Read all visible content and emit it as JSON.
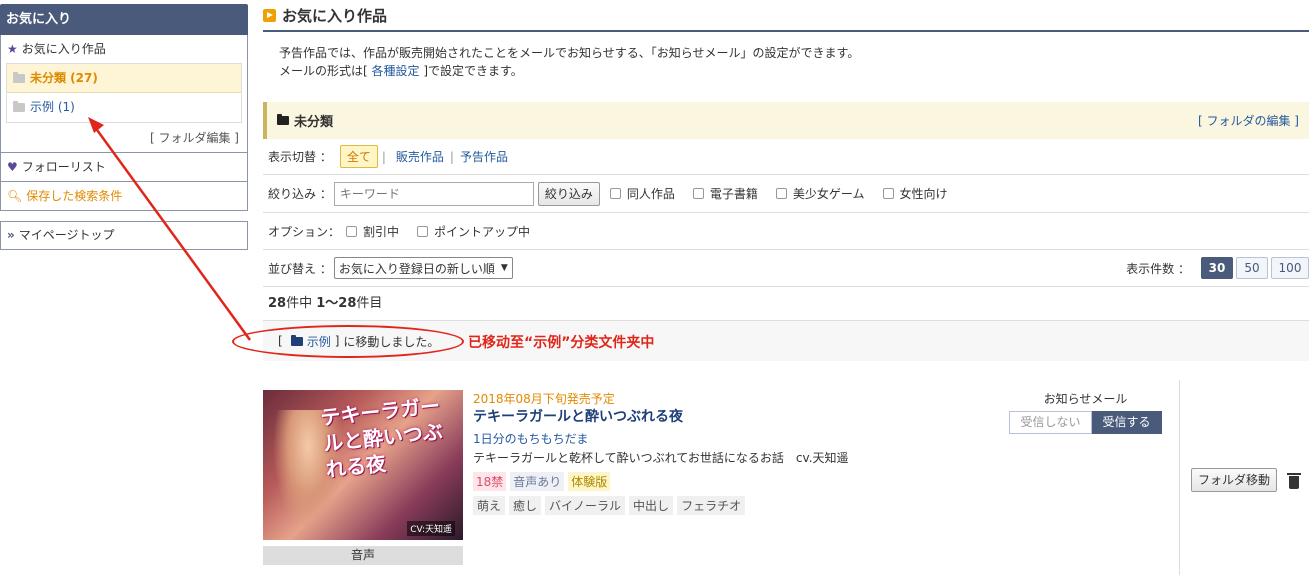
{
  "sidebar": {
    "header": "お気に入り",
    "favorites_label": "お気に入り作品",
    "folders": [
      {
        "label": "未分類 (27)"
      },
      {
        "label": "示例 (1)"
      }
    ],
    "folder_edit": "[ フォルダ編集 ]",
    "follow_list": "フォローリスト",
    "saved_search": "保存した検索条件",
    "mypage_top": "マイページトップ"
  },
  "main": {
    "title": "お気に入り作品",
    "intro_line1": "予告作品では、作品が販売開始されたことをメールでお知らせする、「お知らせメール」の設定ができます。",
    "intro_line2_pre": "メールの形式は[ ",
    "intro_line2_link": "各種設定",
    "intro_line2_post": " ]で設定できます。",
    "folder_name": "未分類",
    "folder_edit_link": "[ フォルダの編集 ]"
  },
  "filters": {
    "display_label": "表示切替 ：",
    "display_all": "全て",
    "display_sale": "販売作品",
    "display_preview": "予告作品",
    "narrow_label": "絞り込み ：",
    "keyword_placeholder": "キーワード",
    "narrow_button": "絞り込み",
    "narrow_options": [
      "同人作品",
      "電子書籍",
      "美少女ゲーム",
      "女性向け"
    ],
    "option_label": "オプション：",
    "option_items": [
      "割引中",
      "ポイントアップ中"
    ],
    "sort_label": "並び替え ：",
    "sort_value": "お気に入り登録日の新しい順",
    "perpage_label": "表示件数 ：",
    "perpage_options": [
      "30",
      "50",
      "100"
    ],
    "perpage_selected": "30"
  },
  "result": {
    "count_total": "28",
    "count_mid": "件中 ",
    "count_range": "1～28",
    "count_suffix": "件目"
  },
  "moved": {
    "bracket_open": "[",
    "folder_link": "示例",
    "bracket_close": "]",
    "message": "に移動しました。",
    "annotation": "已移动至“示例”分类文件夹中"
  },
  "work": {
    "thumb_title": "テキーラガールと酔いつぶれる夜",
    "thumb_credit": "CV:天知遥",
    "category": "音声",
    "release": "2018年08月下旬発売予定",
    "title": "テキーラガールと酔いつぶれる夜",
    "circle": "1日分のもちもちだま",
    "description": "テキーラガールと乾杯して酔いつぶれてお世話になるお話　cv.天知遥",
    "tags": [
      "18禁",
      "音声あり",
      "体験版"
    ],
    "genres": [
      "萌え",
      "癒し",
      "バイノーラル",
      "中出し",
      "フェラチオ"
    ],
    "notify_label": "お知らせメール",
    "notify_off": "受信しない",
    "notify_on": "受信する",
    "move_button": "フォルダ移動"
  },
  "colors": {
    "header_bg": "#4a5a7a",
    "accent_orange": "#e08a00",
    "link_blue": "#245a9e",
    "annotation_red": "#e0261a"
  }
}
